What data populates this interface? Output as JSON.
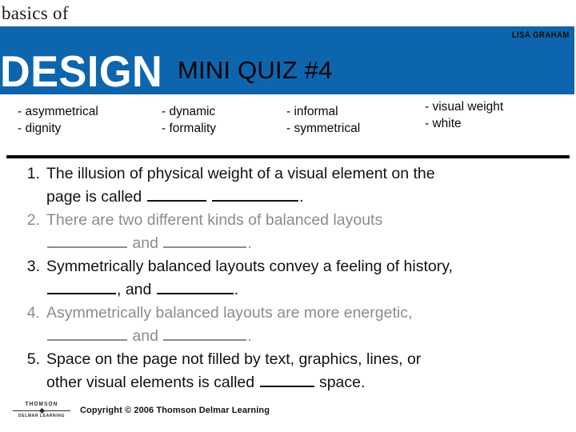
{
  "header": {
    "brand_line1": "basics of",
    "brand_line2": "DESIGN",
    "author": "LISA GRAHAM",
    "title": "MINI QUIZ #4",
    "blue": "#0d66ad"
  },
  "word_bank": {
    "columns": [
      {
        "items": [
          "- asymmetrical",
          "- dignity"
        ]
      },
      {
        "items": [
          "- dynamic",
          "- formality"
        ]
      },
      {
        "items": [
          "- informal",
          "- symmetrical"
        ]
      },
      {
        "items": [
          "- visual weight",
          "- white"
        ]
      }
    ]
  },
  "questions": [
    {
      "number": "1.",
      "line1": "The illusion of physical weight of a visual element on the",
      "line2_a": "page is called ",
      "line2_b": " ",
      "line2_c": ".",
      "dim": false
    },
    {
      "number": "2.",
      "line1": "There are two different kinds of balanced layouts",
      "line2_a": "",
      "line2_b": " and ",
      "line2_c": ".",
      "dim": true
    },
    {
      "number": "3.",
      "line1": "Symmetrically balanced layouts convey a feeling of history,",
      "line2_a": "",
      "line2_b": ", and ",
      "line2_c": ".",
      "dim": false
    },
    {
      "number": "4.",
      "line1": "Asymmetrically balanced layouts are more energetic,",
      "line2_a": "",
      "line2_b": " and ",
      "line2_c": ".",
      "dim": true
    },
    {
      "number": "5.",
      "line1": "Space on the page not filled by text, graphics, lines, or",
      "line2_a": "other visual elements is called ",
      "line2_b": " space.",
      "line2_c": "",
      "dim": false
    }
  ],
  "footer": {
    "logo_top": "THOMSON",
    "logo_bottom": "DELMAR LEARNING",
    "copyright": "Copyright © 2006 Thomson Delmar Learning"
  }
}
